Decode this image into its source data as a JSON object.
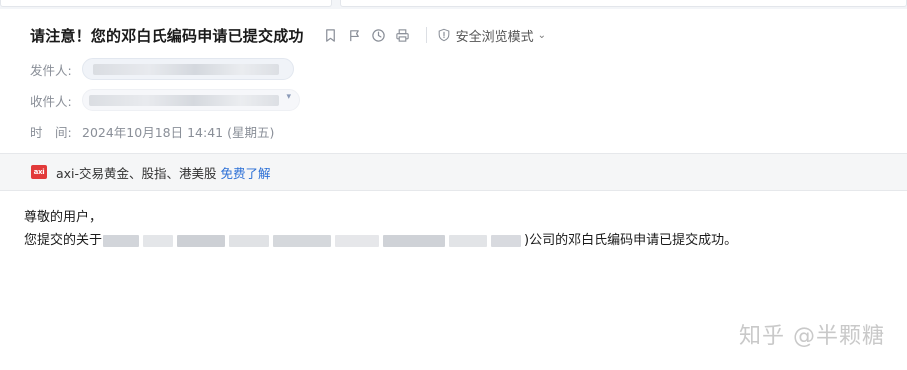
{
  "email": {
    "subject": "请注意！您的邓白氏编码申请已提交成功",
    "toolbar": {
      "icons": [
        "bookmark-icon",
        "flag-icon",
        "clock-icon",
        "print-icon"
      ],
      "safe_mode_label": "安全浏览模式",
      "safe_mode_chevron": "⌄"
    },
    "from_label": "发件人:",
    "to_label": "收件人:",
    "time_label": "时　间:",
    "time_value": "2024年10月18日 14:41 (星期五)"
  },
  "ad": {
    "logo_text": "axi",
    "text": "axi-交易黄金、股指、港美股",
    "link": "免费了解"
  },
  "body": {
    "greeting": "尊敬的用户，",
    "line2_prefix": "您提交的关于",
    "line2_suffix": ")公司的邓白氏编码申请已提交成功。"
  },
  "watermark": "知乎 @半颗糖",
  "colors": {
    "link": "#2b6fd6",
    "ad_logo": "#e23a3a",
    "label_gray": "#8a8f98"
  }
}
